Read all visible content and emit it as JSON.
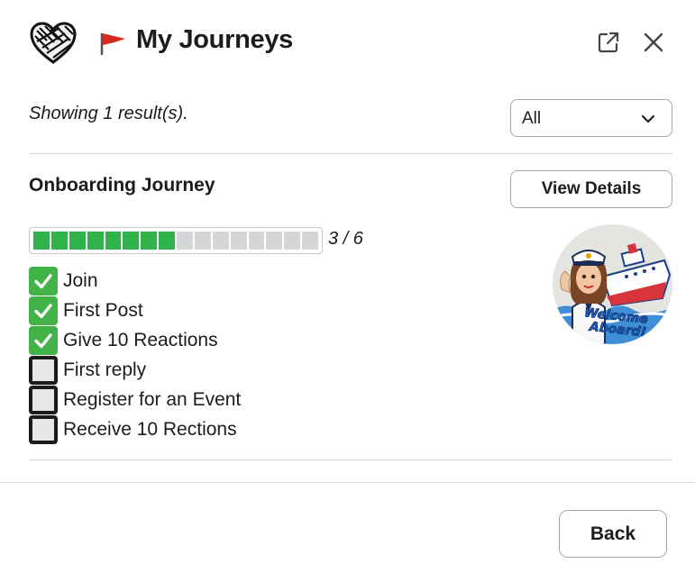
{
  "header": {
    "title": "My Journeys",
    "logo_icon": "rope-heart-icon",
    "flag_icon": "red-flag-icon",
    "popout_icon": "external-link-icon",
    "close_icon": "close-icon"
  },
  "filter": {
    "result_text": "Showing 1 result(s).",
    "selected": "All"
  },
  "journey": {
    "title": "Onboarding Journey",
    "view_details_label": "View Details",
    "progress": {
      "completed": 3,
      "total": 6,
      "text": "3 / 6"
    },
    "tasks": [
      {
        "label": "Join",
        "done": true
      },
      {
        "label": "First Post",
        "done": true
      },
      {
        "label": "Give 10 Reactions",
        "done": true
      },
      {
        "label": "First reply",
        "done": false
      },
      {
        "label": "Register for an Event",
        "done": false
      },
      {
        "label": "Receive 10 Rections",
        "done": false
      }
    ],
    "badge": {
      "icon": "welcome-aboard-badge",
      "text_line1": "Welcome",
      "text_line2": "Aboard!"
    }
  },
  "footer": {
    "back_label": "Back"
  },
  "colors": {
    "progress_fill": "#2fb34a",
    "progress_empty": "#d6d6d6",
    "check_green": "#42b347",
    "flag_red": "#d42a20"
  }
}
